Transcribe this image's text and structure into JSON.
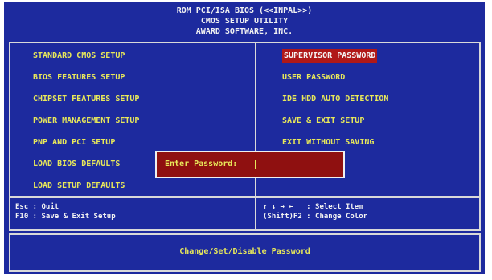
{
  "header": {
    "line1": "ROM PCI/ISA BIOS (<<INPAL>>)",
    "line2": "CMOS SETUP UTILITY",
    "line3": "AWARD SOFTWARE, INC."
  },
  "menu": {
    "left": [
      "STANDARD CMOS SETUP",
      "BIOS FEATURES SETUP",
      "CHIPSET FEATURES SETUP",
      "POWER MANAGEMENT SETUP",
      "PNP AND PCI SETUP",
      "LOAD BIOS DEFAULTS",
      "LOAD SETUP DEFAULTS"
    ],
    "right": [
      "SUPERVISOR PASSWORD",
      "USER PASSWORD",
      "IDE HDD AUTO DETECTION",
      "SAVE & EXIT SETUP",
      "EXIT WITHOUT SAVING"
    ]
  },
  "help": {
    "left_line1": "Esc : Quit",
    "left_line2": "F10 : Save & Exit Setup",
    "right_line1": "↑ ↓ → ←   : Select Item",
    "right_line2": "(Shift)F2 : Change Color"
  },
  "dialog": {
    "label": "Enter Password:"
  },
  "status": "Change/Set/Disable Password",
  "colors": {
    "background": "#1d2a9e",
    "menu_text": "#e8e85a",
    "highlight": "#b01818"
  }
}
